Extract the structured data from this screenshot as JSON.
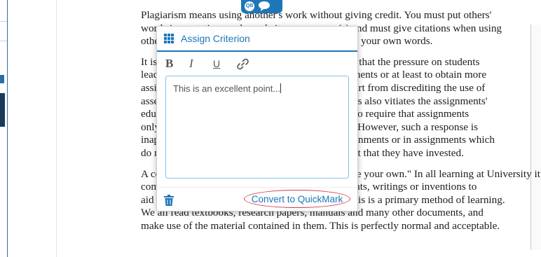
{
  "document": {
    "paragraphs": [
      [
        "Plagiarism means using another's work without giving credit. You must put others'",
        "words in quotation marks and cite your source(s) and must give citations when using",
        "others' ideas, even if those ideas are paraphrased in your own words."
      ],
      [
        "It is now widely recognised by university lecturers that the pressure on students",
        "leads many to copy the work of others into assignments or at least to obtain more",
        "assistance than is permitted for assessed work. Apart from discrediting the use of",
        "assessment, the practice of plagiarising assignments also vitiates the assignments'",
        "educational value. One administrative response is to require that assignments",
        "only be submitted in electronic form for checking. However, such a response is",
        "inappropriate for students submitting original assignments or in assignments which",
        "do not reflect the student's own work, and the effort that they have invested."
      ],
      [
        "A central principle of university work is \"Reference your own.\" In all learning at University it is",
        "common to use and reference other people's thoughts, writings or inventions to",
        "aid our own learning and understanding. Indeed, this is a primary method of learning.",
        "We all read textbooks, research papers, manuals and many other documents, and",
        "make use of the material contained in them. This is perfectly normal and acceptable."
      ]
    ]
  },
  "badge": {
    "label": "QB"
  },
  "popup": {
    "title": "Assign Criterion",
    "toolbar": {
      "bold": "B",
      "italic": "I",
      "underline": "U"
    },
    "comment_text": "This is an excellent point...",
    "convert_label": "Convert to QuickMark"
  },
  "colors": {
    "accent": "#1c76b8",
    "highlight_ring": "#d0404a",
    "editor_border": "#7ec4ec"
  },
  "icons": [
    "grid-icon",
    "link-icon",
    "trash-icon",
    "speech-bubble-icon"
  ]
}
